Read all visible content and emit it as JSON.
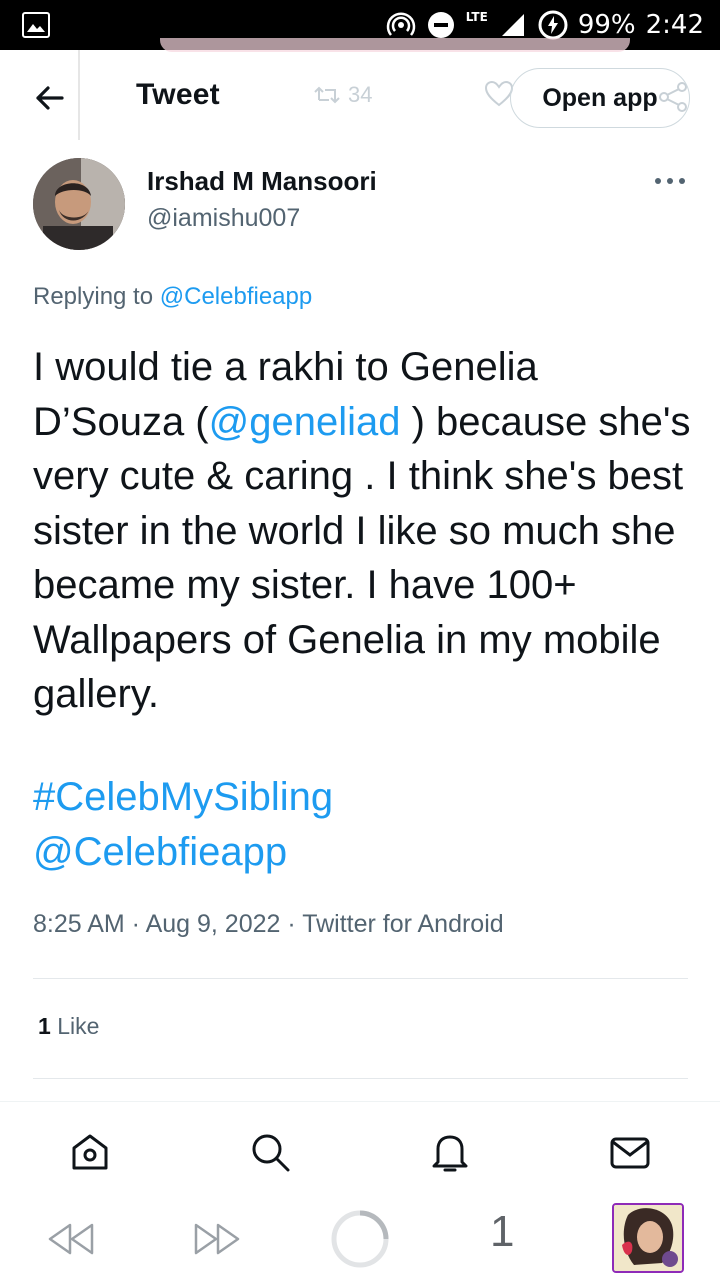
{
  "status_bar": {
    "network": "LTE",
    "battery": "99%",
    "time": "2:42"
  },
  "background": {
    "retweet_count": "34"
  },
  "header": {
    "title": "Tweet",
    "open_app_label": "Open app"
  },
  "author": {
    "name": "Irshad M Mansoori",
    "handle": "@iamishu007"
  },
  "replying": {
    "prefix": "Replying to",
    "target": "@Celebfieapp"
  },
  "tweet": {
    "text_before": "I would tie a rakhi to Genelia D’Souza (",
    "mention": "@geneliad",
    "text_after": " ) because she's very cute & caring . I think she's best sister in the world I like so much she became my sister. I have 100+ Wallpapers of Genelia in my mobile gallery.",
    "hashtag": "#CelebMySibling",
    "mention2": "@Celebfieapp"
  },
  "meta": {
    "time": "8:25 AM",
    "date": "Aug 9, 2022",
    "source": "Twitter for Android",
    "separator": " · "
  },
  "engagement": {
    "likes_count": "1",
    "likes_label": "Like"
  },
  "bottom_nav": {
    "items": [
      "home-icon",
      "search-icon",
      "notifications-icon",
      "messages-icon"
    ]
  },
  "browser": {
    "tab_count": "1"
  },
  "colors": {
    "link": "#1d9bf0",
    "text": "#0f1419",
    "secondary": "#536471",
    "tab_border": "#8e2bb8"
  }
}
